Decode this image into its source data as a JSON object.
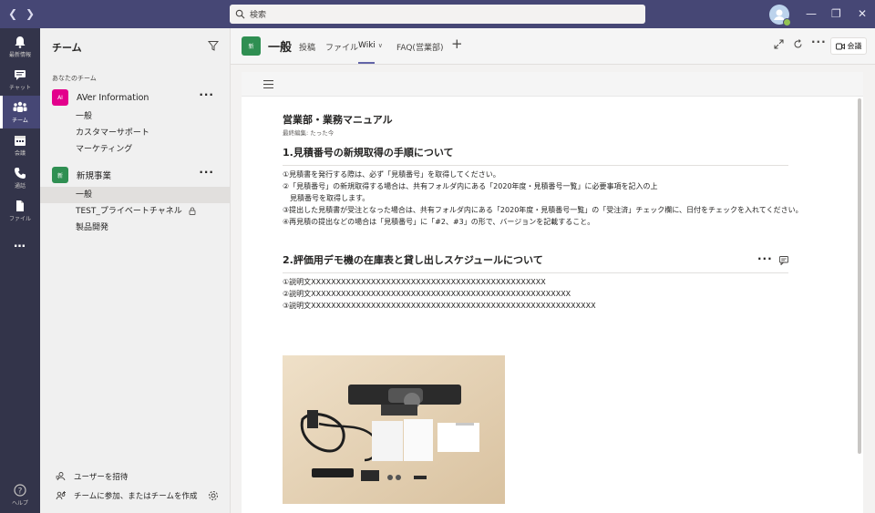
{
  "search": {
    "placeholder": "検索"
  },
  "rail": [
    {
      "label": "最新情報",
      "icon": "bell-icon"
    },
    {
      "label": "チャット",
      "icon": "chat-icon"
    },
    {
      "label": "チーム",
      "icon": "teams-icon",
      "active": true
    },
    {
      "label": "会議",
      "icon": "calendar-icon"
    },
    {
      "label": "通話",
      "icon": "phone-icon"
    },
    {
      "label": "ファイル",
      "icon": "file-icon"
    },
    {
      "label": "...",
      "icon": "more-icon"
    }
  ],
  "rail_help": "ヘルプ",
  "panel": {
    "title": "チーム",
    "section_label": "あなたのチーム",
    "teams": [
      {
        "initials": "AI",
        "name": "AVer Information",
        "color": "#e3008c",
        "channels": [
          "一般",
          "カスタマーサポート",
          "マーケティング"
        ]
      },
      {
        "initials": "新",
        "name": "新規事業",
        "color": "#2f8f52",
        "channels": [
          "一般",
          "TEST_プライベートチャネル",
          "製品開発"
        ]
      }
    ],
    "invite_label": "ユーザーを招待",
    "join_label": "チームに参加、またはチームを作成"
  },
  "header": {
    "channel_initial": "新",
    "channel_name": "一般",
    "tabs": [
      "投稿",
      "ファイル",
      "Wiki",
      "FAQ(営業部)"
    ],
    "active_tab": "Wiki",
    "meet_label": "会議"
  },
  "wiki": {
    "page_title": "営業部・業務マニュアル",
    "last_edited": "最終編集: たった今",
    "sections": [
      {
        "title": "1.見積番号の新規取得の手順について",
        "lines": [
          "①見積書を発行する際は、必ず「見積番号」を取得してください。",
          "②「見積番号」の新規取得する場合は、共有フォルダ内にある「2020年度・見積番号一覧」に必要事項を記入の上",
          "　見積番号を取得します。",
          "③提出した見積書が受注となった場合は、共有フォルダ内にある「2020年度・見積番号一覧」の「受注済」チェック欄に、日付をチェックを入れてください。",
          "④再見積の提出などの場合は「見積番号」に「#2、#3」の形で、バージョンを記載すること。"
        ]
      },
      {
        "title": "2.評価用デモ機の在庫表と貸し出しスケジュールについて",
        "lines": [
          "①説明文XXXXXXXXXXXXXXXXXXXXXXXXXXXXXXXXXXXXXXXXXXXXXXX",
          "②説明文XXXXXXXXXXXXXXXXXXXXXXXXXXXXXXXXXXXXXXXXXXXXXXXXXXXX",
          "③説明文XXXXXXXXXXXXXXXXXXXXXXXXXXXXXXXXXXXXXXXXXXXXXXXXXXXXXXXXX"
        ]
      }
    ]
  }
}
